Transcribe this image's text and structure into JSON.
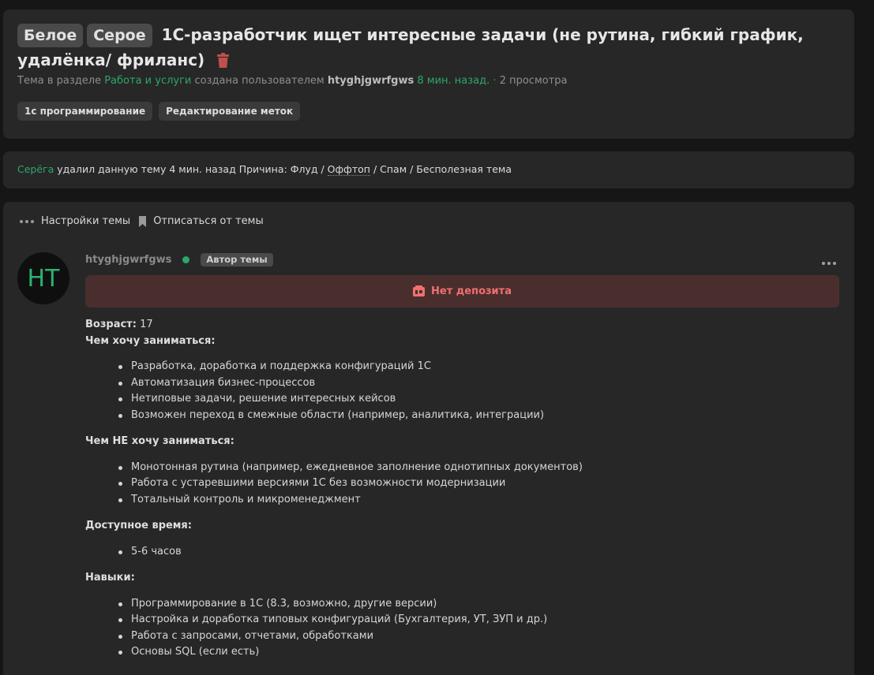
{
  "thread": {
    "prefixes": [
      "Белое",
      "Серое"
    ],
    "title": "1С-разработчик ищет интересные задачи (не рутина, гибкий график, удалёнка/ фриланс)",
    "meta": {
      "prefix_text": "Тема в разделе",
      "section": "Работа и услуги",
      "created_by": "создана пользователем",
      "author": "htyghjgwrfgws",
      "time": "8 мин. назад.",
      "views": "2 просмотра"
    },
    "tags": [
      "1с программирование",
      "Редактирование меток"
    ]
  },
  "deletion_notice": {
    "user": "Серёга",
    "text_before": "удалил данную тему 4 мин. назад Причина: Флуд /",
    "reason_link": "Оффтоп",
    "text_after": "/ Спам / Бесполезная тема"
  },
  "thread_actions": {
    "settings": "Настройки темы",
    "unsubscribe": "Отписаться от темы"
  },
  "post": {
    "avatar_initials": "HT",
    "username": "htyghjgwrfgws",
    "badge": "Автор темы",
    "no_deposit": "Нет депозита",
    "age_label": "Возраст:",
    "age_value": "17",
    "want_label": "Чем хочу заниматься:",
    "want_items": [
      "Разработка, доработка и поддержка конфигураций 1С",
      "Автоматизация бизнес-процессов",
      "Нетиповые задачи, решение интересных кейсов",
      "Возможен переход в смежные области (например, аналитика, интеграции)"
    ],
    "not_want_label": "Чем НЕ хочу заниматься:",
    "not_want_items": [
      "Монотонная рутина (например, ежедневное заполнение однотипных документов)",
      "Работа с устаревшими версиями 1С без возможности модернизации",
      "Тотальный контроль и микроменеджмент"
    ],
    "time_label": "Доступное время:",
    "time_items": [
      "5-6 часов"
    ],
    "skills_label": "Навыки:",
    "skills_items": [
      "Программирование в 1С (8.3, возможно, другие версии)",
      "Настройка и доработка типовых конфигураций (Бухгалтерия, УТ, ЗУП и др.)",
      "Работа с запросами, отчетами, обработками",
      "Основы SQL (если есть)"
    ]
  },
  "colors": {
    "accent_green": "#2ba86a",
    "danger_red": "#f07070",
    "trash_red": "#c0504d"
  },
  "icons": [
    "trash-icon",
    "dots-icon",
    "bookmark-icon",
    "wallet-icon",
    "post-menu-icon"
  ]
}
